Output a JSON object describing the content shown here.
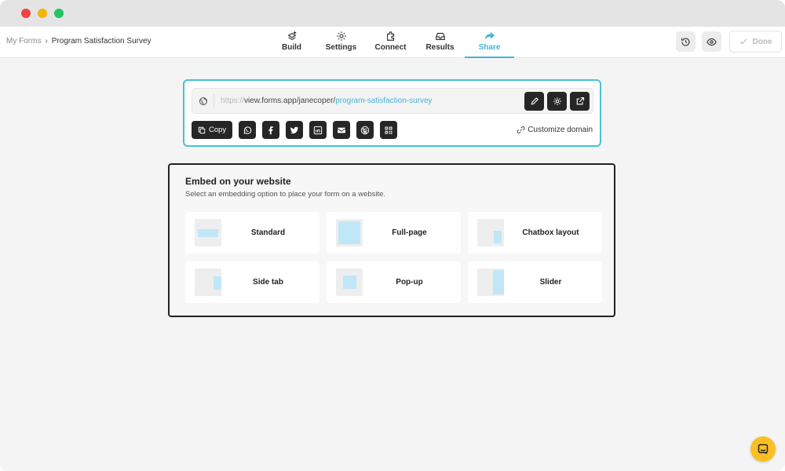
{
  "breadcrumb": {
    "root": "My Forms",
    "separator": "›",
    "current": "Program Satisfaction Survey"
  },
  "tabs": [
    {
      "label": "Build",
      "icon": "build-icon"
    },
    {
      "label": "Settings",
      "icon": "gear-icon"
    },
    {
      "label": "Connect",
      "icon": "puzzle-icon"
    },
    {
      "label": "Results",
      "icon": "inbox-icon"
    },
    {
      "label": "Share",
      "icon": "share-icon",
      "active": true
    }
  ],
  "header": {
    "done_label": "Done"
  },
  "share": {
    "url_protocol": "https://",
    "url_host": "view.forms.app/janecoper/",
    "url_slug": "program-satisfaction-survey",
    "copy_label": "Copy",
    "customize_label": "Customize domain"
  },
  "embed": {
    "title": "Embed on your website",
    "subtitle": "Select an embedding option to place your form on a website.",
    "options": [
      {
        "label": "Standard"
      },
      {
        "label": "Full-page"
      },
      {
        "label": "Chatbox layout"
      },
      {
        "label": "Side tab"
      },
      {
        "label": "Pop-up"
      },
      {
        "label": "Slider"
      }
    ]
  },
  "colors": {
    "accent": "#46b6d8",
    "dark": "#262626",
    "chat": "#fbbf24"
  }
}
